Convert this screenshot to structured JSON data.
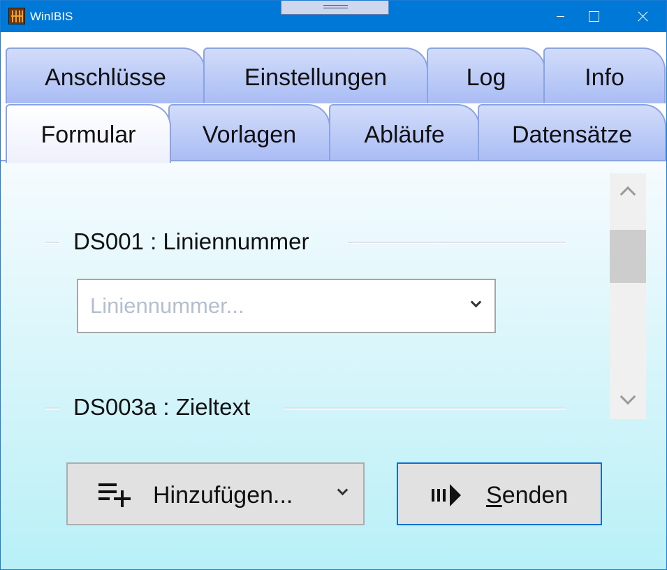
{
  "window": {
    "title": "WinIBIS"
  },
  "tabs": {
    "row1": [
      {
        "label": "Anschlüsse"
      },
      {
        "label": "Einstellungen"
      },
      {
        "label": "Log"
      },
      {
        "label": "Info"
      }
    ],
    "row2": [
      {
        "label": "Formular",
        "active": true
      },
      {
        "label": "Vorlagen"
      },
      {
        "label": "Abläufe"
      },
      {
        "label": "Datensätze"
      }
    ]
  },
  "form": {
    "groups": [
      {
        "header": "DS001 : Liniennummer",
        "field": {
          "placeholder": "Liniennummer...",
          "value": ""
        }
      },
      {
        "header": "DS003a : Zieltext"
      }
    ]
  },
  "actions": {
    "add_label": "Hinzufügen...",
    "send_label_underlined": "S",
    "send_label_rest": "enden"
  },
  "icons": {
    "add": "playlist-add-icon",
    "send": "send-arrow-icon",
    "dropdown": "chevron-down-icon"
  },
  "colors": {
    "titlebar": "#0078d7",
    "tab_fill": "#b9c9f6",
    "tab_border": "#8aa3e2",
    "focus_border": "#0f6fd1"
  }
}
